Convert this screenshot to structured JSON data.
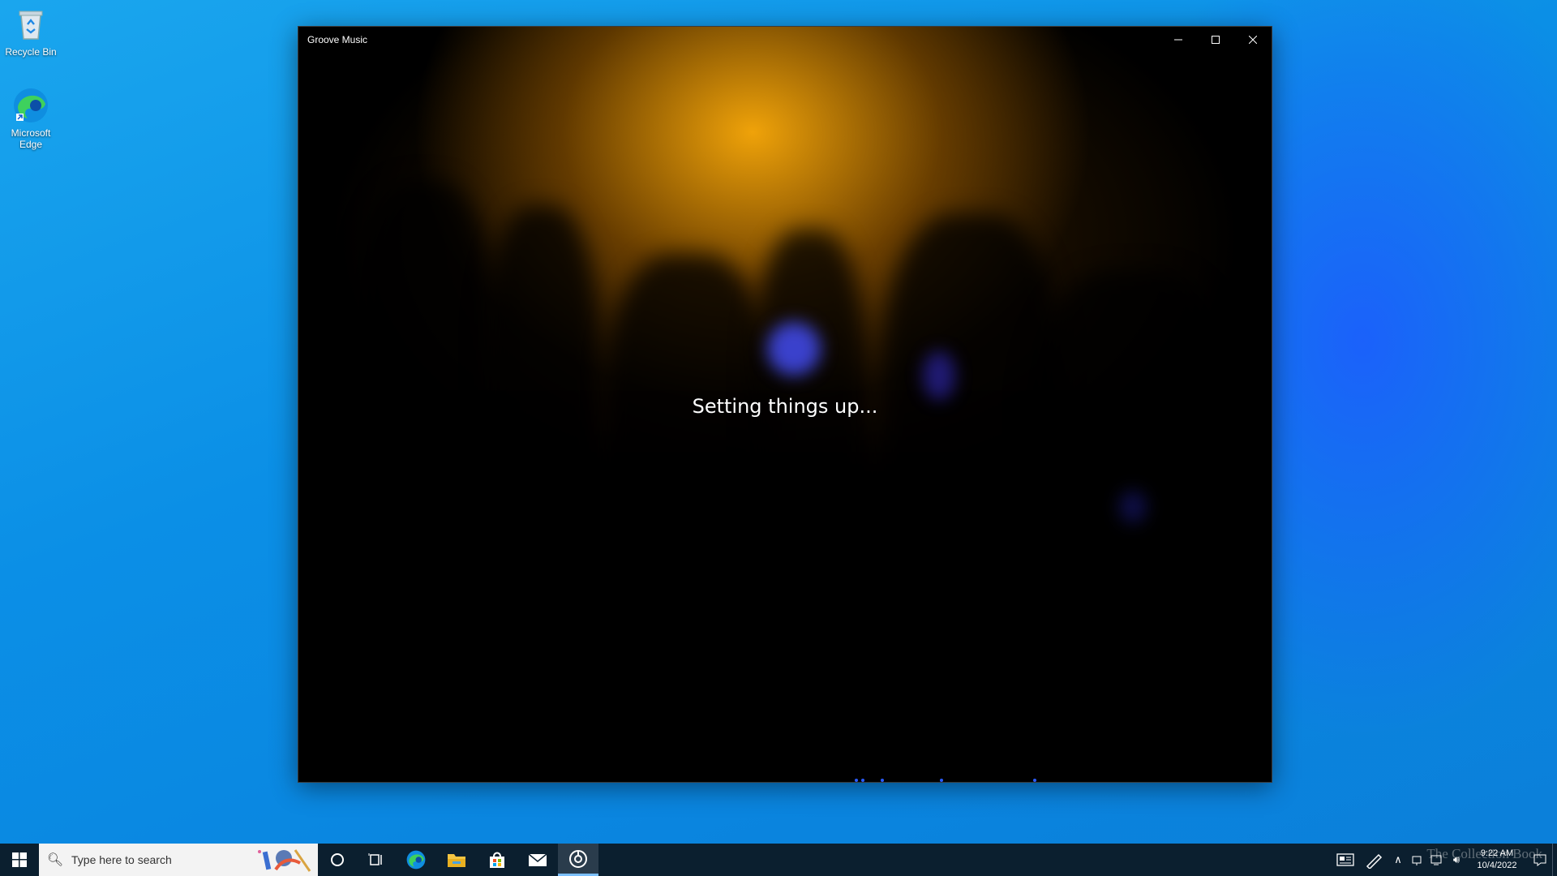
{
  "desktop": {
    "icons": [
      {
        "label": "Recycle Bin",
        "icon": "recycle-bin-icon"
      },
      {
        "label": "Microsoft Edge",
        "icon": "edge-icon"
      }
    ]
  },
  "window": {
    "title": "Groove Music",
    "loading_text": "Setting things up...",
    "controls": {
      "minimize": "minimize-icon",
      "maximize": "maximize-icon",
      "close": "close-icon"
    }
  },
  "taskbar": {
    "search": {
      "placeholder": "Type here to search"
    },
    "pinned": [
      "cortana-icon",
      "task-view-icon",
      "edge-icon",
      "file-explorer-icon",
      "store-icon",
      "mail-icon",
      "groove-music-icon"
    ],
    "active_app": "groove-music-icon",
    "clock": {
      "time": "9:22 AM",
      "date": "10/4/2022"
    }
  },
  "watermark": "The Collection Book",
  "colors": {
    "accent": "#7cc0ff",
    "taskbar": "#0b1f2f",
    "desktop": "#0a86e0"
  }
}
